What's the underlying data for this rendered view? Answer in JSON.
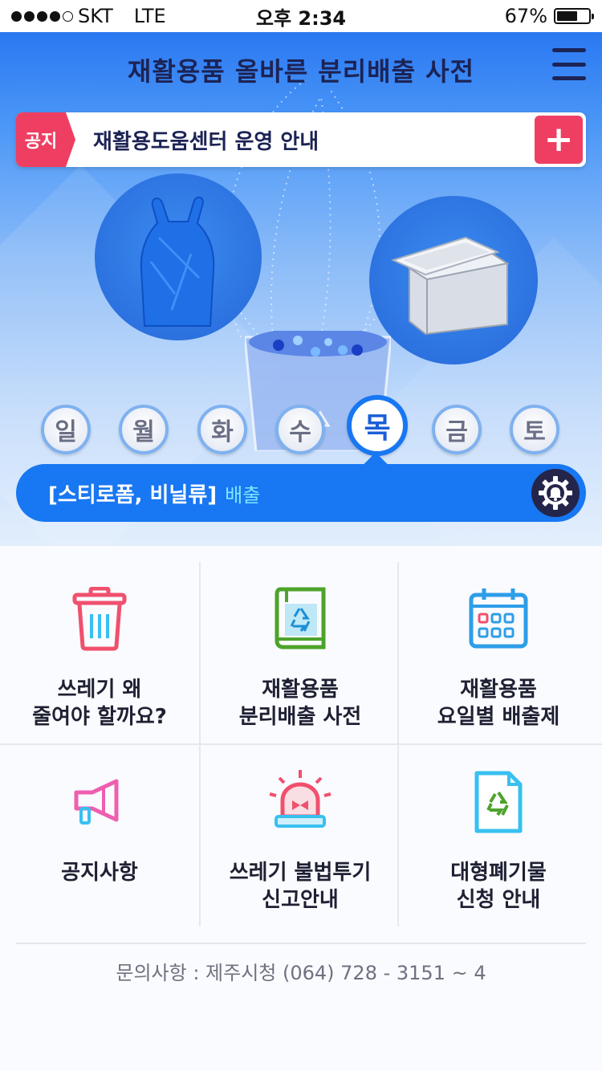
{
  "status_bar": {
    "carrier": "SKT",
    "network": "LTE",
    "time": "오후 2:34",
    "battery_percent": "67%",
    "battery_level": 0.67
  },
  "header": {
    "title": "재활용품 올바른 분리배출 사전",
    "menu_icon": "hamburger-menu-icon"
  },
  "notice": {
    "tag": "공지",
    "text": "재활용도움센터 운영 안내",
    "plus_icon": "plus-icon",
    "accent": "#ee3f63"
  },
  "days": [
    {
      "label": "일",
      "active": false
    },
    {
      "label": "월",
      "active": false
    },
    {
      "label": "화",
      "active": false
    },
    {
      "label": "수",
      "active": false
    },
    {
      "label": "목",
      "active": true
    },
    {
      "label": "금",
      "active": false
    },
    {
      "label": "토",
      "active": false
    }
  ],
  "pickup": {
    "items": "[스티로폼, 비닐류]",
    "suffix": "배출",
    "alarm_icon": "gear-bell-icon",
    "bar_color": "#1877f2"
  },
  "menu": [
    {
      "line1": "쓰레기 왜",
      "line2": "줄여야 할까요?",
      "icon": "trash-can-icon"
    },
    {
      "line1": "재활용품",
      "line2": "분리배출 사전",
      "icon": "recycle-book-icon"
    },
    {
      "line1": "재활용품",
      "line2": "요일별 배출제",
      "icon": "calendar-icon"
    },
    {
      "line1": "공지사항",
      "line2": "",
      "icon": "megaphone-icon"
    },
    {
      "line1": "쓰레기 불법투기",
      "line2": "신고안내",
      "icon": "siren-icon"
    },
    {
      "line1": "대형폐기물",
      "line2": "신청 안내",
      "icon": "recycle-document-icon"
    }
  ],
  "contact": "문의사항 : 제주시청 (064) 728 - 3151 ~ 4"
}
